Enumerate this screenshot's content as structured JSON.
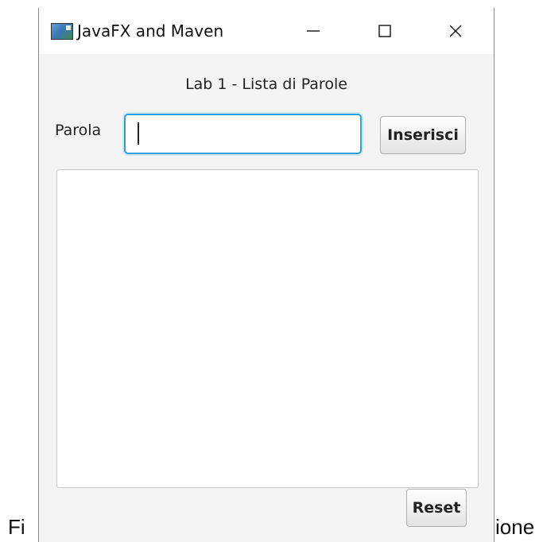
{
  "window": {
    "title": "JavaFX and Maven",
    "icon": "javafx-app-icon",
    "controls": {
      "minimize": "minimize-icon",
      "maximize": "maximize-icon",
      "close": "close-icon"
    }
  },
  "app": {
    "header": "Lab 1 - Lista di Parole",
    "parola_label": "Parola",
    "parola_input": {
      "value": "",
      "placeholder": ""
    },
    "insert_button": "Inserisci",
    "words_list": [],
    "reset_button": "Reset"
  },
  "caption": {
    "left_fragment": "Fi",
    "right_fragment": "ione"
  },
  "colors": {
    "focus_border": "#2f9fd8",
    "window_background": "#f4f4f4"
  }
}
